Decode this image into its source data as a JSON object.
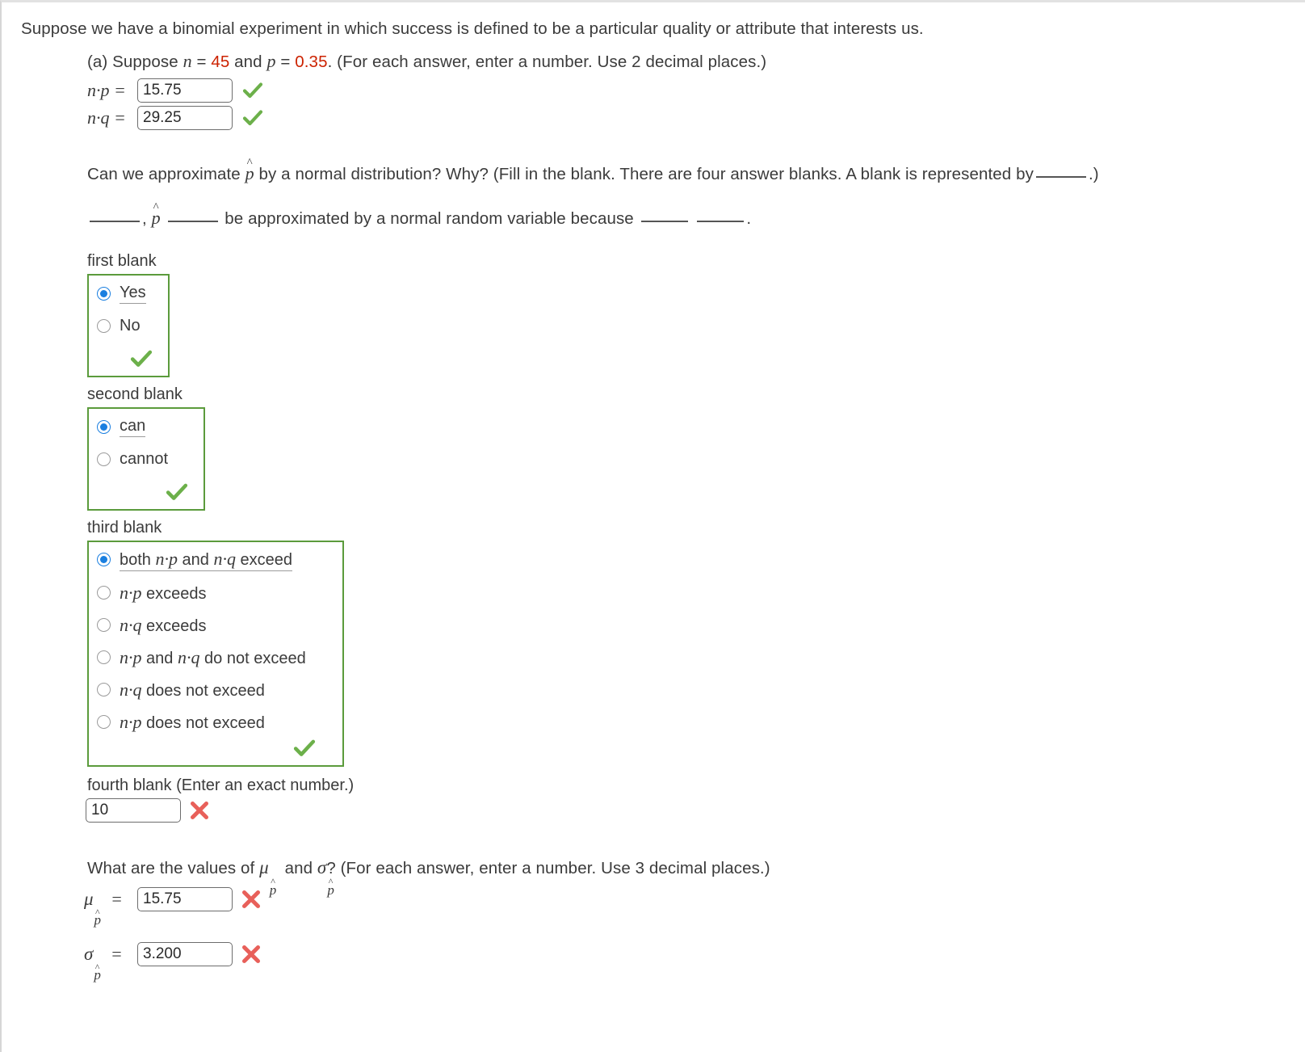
{
  "intro": {
    "text": "Suppose we have a binomial experiment in which success is defined to be a particular quality or attribute that interests us."
  },
  "part_a": {
    "prefix": "(a) Suppose",
    "var_n": "n",
    "eq1": "=",
    "n_value": "45",
    "and": "and",
    "var_p": "p",
    "eq2": "=",
    "p_value": "0.35",
    "suffix": ". (For each answer, enter a number. Use 2 decimal places.)",
    "rows": [
      {
        "label": "n·p  =",
        "value": "15.75",
        "status": "correct"
      },
      {
        "label": "n·q  =",
        "value": "29.25",
        "status": "correct"
      }
    ]
  },
  "question": {
    "line1_a": "Can we approximate",
    "line1_phat": "p",
    "line1_b": "by a normal distribution? Why? (Fill in the blank. There are four answer blanks. A blank is represented by",
    "line1_c": ".)",
    "line2_a": ",",
    "line2_phat": "p",
    "line2_b": "be approximated by a normal random variable because",
    "line2_c": "."
  },
  "blanks": [
    {
      "label": "first blank",
      "status": "correct",
      "options": [
        {
          "text": "Yes",
          "selected": true
        },
        {
          "text": "No",
          "selected": false
        }
      ]
    },
    {
      "label": "second blank",
      "status": "correct",
      "options": [
        {
          "text": "can",
          "selected": true
        },
        {
          "text": "cannot",
          "selected": false
        }
      ]
    },
    {
      "label": "third blank",
      "status": "correct",
      "options": [
        {
          "text": "both n·p and n·q exceed",
          "selected": true
        },
        {
          "text": "n·p exceeds",
          "selected": false
        },
        {
          "text": "n·q exceeds",
          "selected": false
        },
        {
          "text": "n·p and n·q do not exceed",
          "selected": false
        },
        {
          "text": "n·q does not exceed",
          "selected": false
        },
        {
          "text": "n·p does not exceed",
          "selected": false
        }
      ]
    }
  ],
  "fourth_blank": {
    "label": "fourth blank (Enter an exact number.)",
    "value": "10",
    "status": "incorrect"
  },
  "part_b": {
    "q_a": "What are the values of",
    "mu": "μ",
    "q_b": "and",
    "sigma": "σ",
    "q_c": "? (For each answer, enter a number. Use 3 decimal places.)",
    "rows": [
      {
        "symbol": "μ",
        "sub": "p",
        "eq": "=",
        "value": "15.75",
        "status": "incorrect"
      },
      {
        "symbol": "σ",
        "sub": "p",
        "eq": "=",
        "value": "3.200",
        "status": "incorrect"
      }
    ]
  },
  "colors": {
    "correct_green": "#6cb04a",
    "incorrect_red": "#e8605a",
    "box_green": "#5b9b3c",
    "radio_blue": "#1a7fe0",
    "value_red": "#cc2200"
  }
}
